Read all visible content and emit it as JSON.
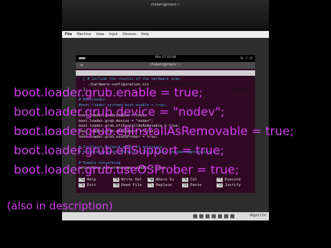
{
  "host": {
    "title": "chelam@niaco:~",
    "menu": [
      "File",
      "Machine",
      "View",
      "Input",
      "Devices",
      "Help"
    ],
    "status_key": "Right Ctrl"
  },
  "guest": {
    "clock": "Mar 27 03:08",
    "tray": [
      "net-icon",
      "volume-icon",
      "power-icon"
    ],
    "terminal_title": "chelam@niaco: ~"
  },
  "nano": {
    "version": "GNU nano 7.2",
    "file": "/etc/nixos/configuration.nix",
    "state": "Modified",
    "lines": [
      {
        "text": "  [ # Include the results of the hardware scan.",
        "type": "comment"
      },
      {
        "text": "    ./hardware-configuration.nix",
        "type": "plain"
      },
      {
        "text": "  ];",
        "type": "plain"
      },
      {
        "text": "",
        "type": "plain"
      },
      {
        "text": "# Bootloader.",
        "type": "comment"
      },
      {
        "text": "#boot.loader.systemd-boot.enable = true;",
        "type": "comment"
      },
      {
        "text": "",
        "type": "plain"
      },
      {
        "text": "boot.loader.grub.enable = true;",
        "type": "plain"
      },
      {
        "text": "boot.loader.grub.device = \"nodev\";",
        "type": "plain"
      },
      {
        "text": "boot.loader.grub.efiInstallAsRemovable = true;",
        "type": "plain"
      },
      {
        "text": "boot.loader.grub.efiSupport = true;",
        "type": "plain"
      },
      {
        "text": "boot.loader.grub.useOSProber = true;",
        "type": "plain"
      },
      {
        "text": "",
        "type": "plain"
      },
      {
        "text": "# Configure network proxy if necessary",
        "type": "comment"
      },
      {
        "text": "# networking.proxy.default = \"http://user:password@proxy:port/\";",
        "type": "comment"
      },
      {
        "text": "",
        "type": "plain"
      },
      {
        "text": "# Enable networking",
        "type": "comment"
      },
      {
        "text": "networking.networkmanager.enable = true;",
        "type": "plain"
      }
    ],
    "help": [
      {
        "key": "^G",
        "label": "Help"
      },
      {
        "key": "^X",
        "label": "Exit"
      },
      {
        "key": "^O",
        "label": "Write Out"
      },
      {
        "key": "^R",
        "label": "Read File"
      },
      {
        "key": "^W",
        "label": "Where Is"
      },
      {
        "key": "^\\",
        "label": "Replace"
      },
      {
        "key": "^K",
        "label": "Cut"
      },
      {
        "key": "^U",
        "label": "Paste"
      },
      {
        "key": "^T",
        "label": "Execute"
      },
      {
        "key": "^J",
        "label": "Justify"
      }
    ]
  },
  "overlay": {
    "lines": [
      "boot.loader.grub.enable = true;",
      "boot.loader.grub.device = \"nodev\";",
      "boot.loader.grub.efiInstallAsRemovable = true;",
      "boot.loader.grub.efiSupport = true;",
      "boot.loader.grub.useOSProber = true;"
    ],
    "note": "(also in description)"
  }
}
